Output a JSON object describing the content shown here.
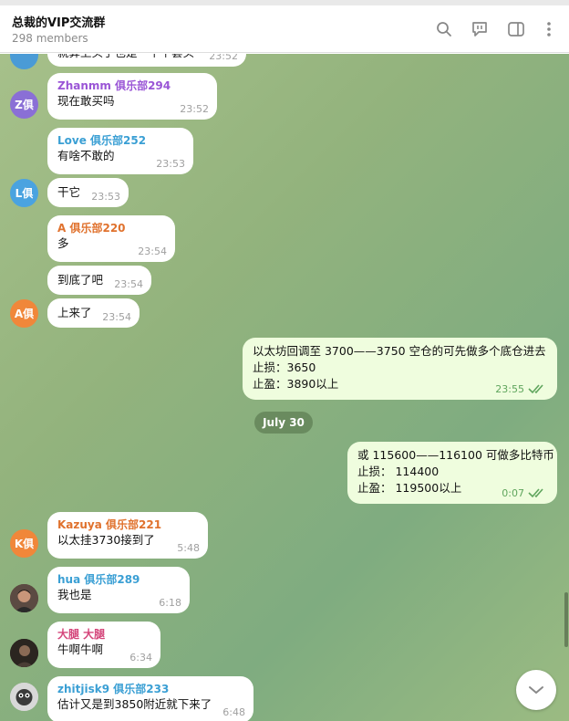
{
  "header": {
    "title": "总裁的VIP交流群",
    "members": "298 members",
    "icons": [
      "search-icon",
      "topic-icon",
      "sidebar-icon",
      "more-icon"
    ]
  },
  "colors": {
    "accent": "#3a8fd9",
    "sent_bubble": "#effdde",
    "sender_purple": "#9a55d6",
    "sender_blue": "#3a9fd4",
    "sender_orange": "#e0722e",
    "sender_pink": "#d4457a"
  },
  "messages": [
    {
      "text": "就算上头了也是一个个套头",
      "time": "23:52"
    },
    {
      "sender": "Zhanmm 俱乐部294",
      "text": "现在敢买吗",
      "time": "23:52",
      "avatar": "Z俱"
    },
    {
      "sender": "Love 俱乐部252",
      "text": "有啥不敢的",
      "time": "23:53"
    },
    {
      "text": "干它",
      "time": "23:53",
      "avatar": "L俱"
    },
    {
      "sender": "A 俱乐部220",
      "text": "多",
      "time": "23:54"
    },
    {
      "text": "到底了吧",
      "time": "23:54"
    },
    {
      "text": "上来了",
      "time": "23:54",
      "avatar": "A俱"
    },
    {
      "lines": [
        "以太坊回调至 3700——3750 空仓的可先做多个底仓进去",
        "止损：3650",
        "止盈：3890以上"
      ],
      "time": "23:55"
    },
    {
      "lines": [
        "或 115600——116100 可做多比特币",
        "止损： 114400",
        "止盈： 119500以上"
      ],
      "time": "0:07"
    },
    {
      "sender": "Kazuya 俱乐部221",
      "text": "以太挂3730接到了",
      "time": "5:48",
      "avatar": "K俱"
    },
    {
      "sender": "hua 俱乐部289",
      "text": "我也是",
      "time": "6:18"
    },
    {
      "sender": "大腿 大腿",
      "text": "牛啊牛啊",
      "time": "6:34"
    },
    {
      "sender": "zhitjisk9 俱乐部233",
      "text": "估计又是到3850附近就下来了",
      "time": "6:48"
    }
  ],
  "date_separator": "July 30"
}
